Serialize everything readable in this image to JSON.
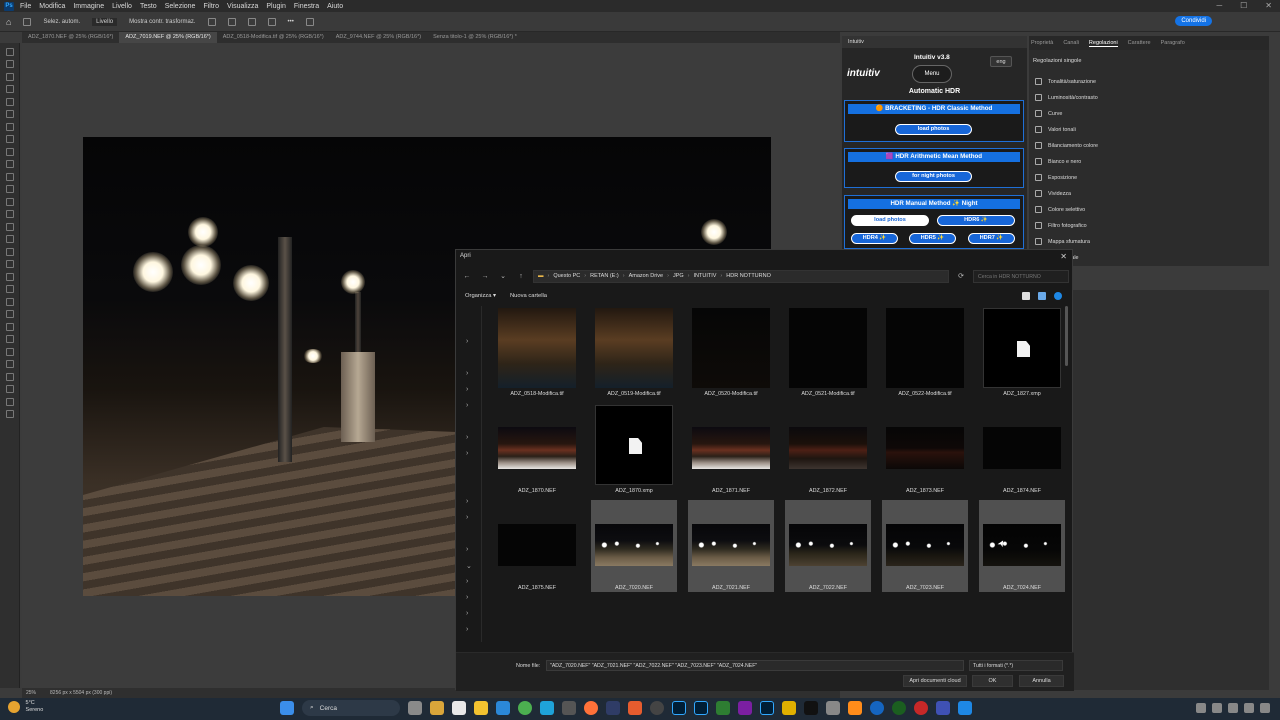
{
  "menubar": {
    "items": [
      "File",
      "Modifica",
      "Immagine",
      "Livello",
      "Testo",
      "Selezione",
      "Filtro",
      "Visualizza",
      "Plugin",
      "Finestra",
      "Aiuto"
    ]
  },
  "options": {
    "auto_select": "Selez. autom.",
    "layer_mode": "Livello",
    "transform": "Mostra contr. trasformaz.",
    "share": "Condividi"
  },
  "doc_tabs": [
    {
      "label": "ADZ_1870.NEF @ 25% (RGB/16*)",
      "active": false
    },
    {
      "label": "ADZ_7019.NEF @ 25% (RGB/16*)",
      "active": true
    },
    {
      "label": "ADZ_0518-Modifica.tif @ 25% (RGB/16*)",
      "active": false
    },
    {
      "label": "ADZ_9744.NEF @ 25% (RGB/16*)",
      "active": false
    },
    {
      "label": "Senza titolo-1 @ 25% (RGB/16*) *",
      "active": false
    }
  ],
  "status": {
    "zoom": "25%",
    "dimensions": "8256 px x 5504 px (300 ppi)"
  },
  "intuitiv": {
    "panel_title": "Intuitiv",
    "logo": "intuitiv",
    "version": "Intuitiv v3.8",
    "menu": "Menu",
    "lang": "eng",
    "title": "Automatic HDR",
    "bracketing_title": "🟠 BRACKETING - HDR Classic Method",
    "bracketing_btn": "load photos",
    "arith_title": "🟪 HDR Arithmetic Mean Method",
    "arith_btn": "for night photos",
    "manual_title": "HDR Manual Method ✨ Night",
    "manual_load": "load photos",
    "hdr6": "HDR6 ✨",
    "hdr4": "HDR4 ✨",
    "hdr5": "HDR5 ✨",
    "hdr7": "HDR7 ✨"
  },
  "adjustments": {
    "tabs": [
      "Proprietà",
      "Canali",
      "Regolazioni",
      "Carattere",
      "Paragrafo"
    ],
    "active_tab": "Regolazioni",
    "heading": "Regolazioni singole",
    "items": [
      "Tonalità/saturazione",
      "Luminosità/contrasto",
      "Curve",
      "Valori tonali",
      "Bilanciamento colore",
      "Bianco e nero",
      "Esposizione",
      "Vividezza",
      "Colore selettivo",
      "Filtro fotografico",
      "Mappa sfumatura",
      "Mixer canale"
    ]
  },
  "dialog": {
    "title": "Apri",
    "path": [
      "Questo PC",
      "RETAN (E:)",
      "Amazon Drive",
      "JPG",
      "INTUITIV",
      "HDR NOTTURNO"
    ],
    "search_placeholder": "Cerca in HDR NOTTURNO",
    "organize": "Organizza ▾",
    "new_folder": "Nuova cartella",
    "files": [
      {
        "name": "ADZ_0518-Modifica.tif",
        "thumb": "t-canal",
        "selected": false,
        "doc": false
      },
      {
        "name": "ADZ_0519-Modifica.tif",
        "thumb": "t-canal",
        "selected": false,
        "doc": false
      },
      {
        "name": "ADZ_0520-Modifica.tif",
        "thumb": "t-dark2",
        "selected": false,
        "doc": false
      },
      {
        "name": "ADZ_0521-Modifica.tif",
        "thumb": "t-dark",
        "selected": false,
        "doc": false
      },
      {
        "name": "ADZ_0522-Modifica.tif",
        "thumb": "t-dark",
        "selected": false,
        "doc": false
      },
      {
        "name": "ADZ_1827.xmp",
        "thumb": "",
        "selected": false,
        "doc": true
      },
      {
        "name": "ADZ_1870.NEF",
        "thumb": "t-street",
        "selected": false,
        "doc": false
      },
      {
        "name": "ADZ_1870.xmp",
        "thumb": "",
        "selected": false,
        "doc": true
      },
      {
        "name": "ADZ_1871.NEF",
        "thumb": "t-street",
        "selected": false,
        "doc": false
      },
      {
        "name": "ADZ_1872.NEF",
        "thumb": "t-street2",
        "selected": false,
        "doc": false
      },
      {
        "name": "ADZ_1873.NEF",
        "thumb": "t-street3",
        "selected": false,
        "doc": false
      },
      {
        "name": "ADZ_1874.NEF",
        "thumb": "t-dark",
        "selected": false,
        "doc": false
      },
      {
        "name": "ADZ_1875.NEF",
        "thumb": "t-dark",
        "selected": false,
        "doc": false
      },
      {
        "name": "ADZ_7020.NEF",
        "thumb": "t-stairs",
        "selected": true,
        "doc": false
      },
      {
        "name": "ADZ_7021.NEF",
        "thumb": "t-stairs",
        "selected": true,
        "doc": false
      },
      {
        "name": "ADZ_7022.NEF",
        "thumb": "t-stairs2",
        "selected": true,
        "doc": false
      },
      {
        "name": "ADZ_7023.NEF",
        "thumb": "t-stairs3",
        "selected": true,
        "doc": false
      },
      {
        "name": "ADZ_7024.NEF",
        "thumb": "t-stairs4",
        "selected": true,
        "doc": false
      }
    ],
    "filename_label": "Nome file:",
    "filename_value": "\"ADZ_7020.NEF\" \"ADZ_7021.NEF\" \"ADZ_7022.NEF\" \"ADZ_7023.NEF\" \"ADZ_7024.NEF\"",
    "filetype": "Tutti i formati (*.*)",
    "cloud_btn": "Apri documenti cloud",
    "ok": "OK",
    "cancel": "Annulla"
  },
  "taskbar": {
    "temp": "5°C",
    "weather": "Sereno",
    "search": "Cerca"
  },
  "colors": {
    "accent": "#1473e6",
    "intuitiv_blue": "#1766d8"
  }
}
